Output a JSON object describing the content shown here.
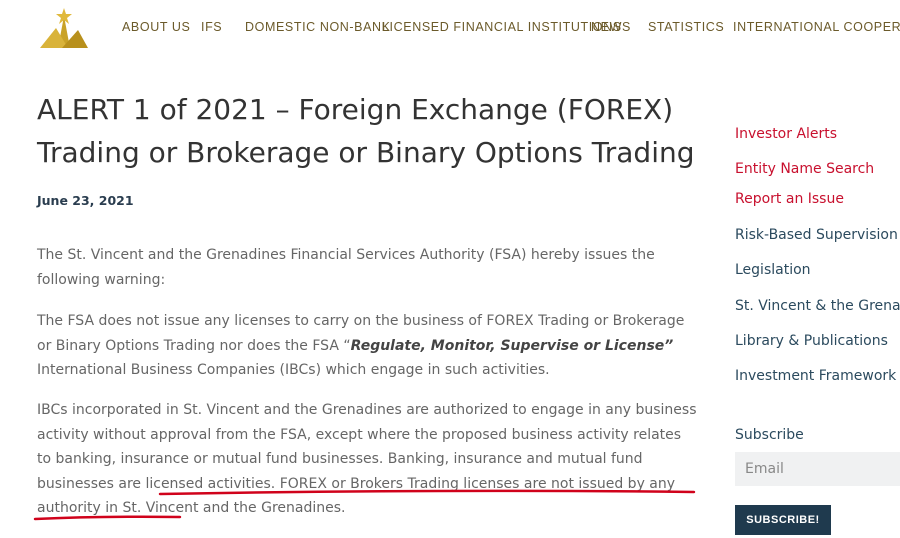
{
  "nav": {
    "items": [
      "ABOUT US",
      "IFS",
      "DOMESTIC NON-BANK",
      "LICENSED FINANCIAL INSTITUTIONS",
      "NEWS",
      "STATISTICS",
      "INTERNATIONAL COOPERATION"
    ]
  },
  "logo": {
    "icon": "fsa-star-logo-icon",
    "color": "#c9a227"
  },
  "article": {
    "title": "ALERT 1 of 2021 – Foreign Exchange (FOREX) Trading or Brokerage or Binary Options Trading",
    "date": "June 23, 2021",
    "p1": "The St. Vincent and the Grenadines Financial Services Authority (FSA) hereby issues the following warning:",
    "p2_a": "The FSA does not issue any licenses to carry on the business of FOREX Trading or Brokerage or Binary Options Trading nor does the FSA “",
    "p2_bold": "Regulate, Monitor, Supervise or License”",
    "p2_c": " International Business Companies (IBCs) which engage in such activities.",
    "p3": "IBCs incorporated in St. Vincent and the Grenadines are authorized to engage in any business activity without approval from the FSA, except where the proposed business activity relates to banking, insurance or mutual fund businesses. Banking, insurance and mutual fund businesses are licensed activities. FOREX or Brokers Trading licenses are not issued by any authority in St. Vincent and the Grenadines."
  },
  "sidebar": {
    "links_red": [
      "Investor Alerts",
      "Entity Name Search",
      "Report an Issue"
    ],
    "links_dark": [
      "Risk-Based Supervision",
      "Legislation",
      "St. Vincent & the Grenadi",
      "Library & Publications",
      "Investment Framework"
    ],
    "subscribe_label": "Subscribe",
    "email_placeholder": "Email",
    "subscribe_button": "SUBSCRIBE!"
  },
  "colors": {
    "nav_text": "#6b5a2a",
    "sidebar_red": "#c8102e",
    "sidebar_dark": "#2b4a5e",
    "button_bg": "#1f3a4e",
    "annotation_red": "#d0021b"
  }
}
